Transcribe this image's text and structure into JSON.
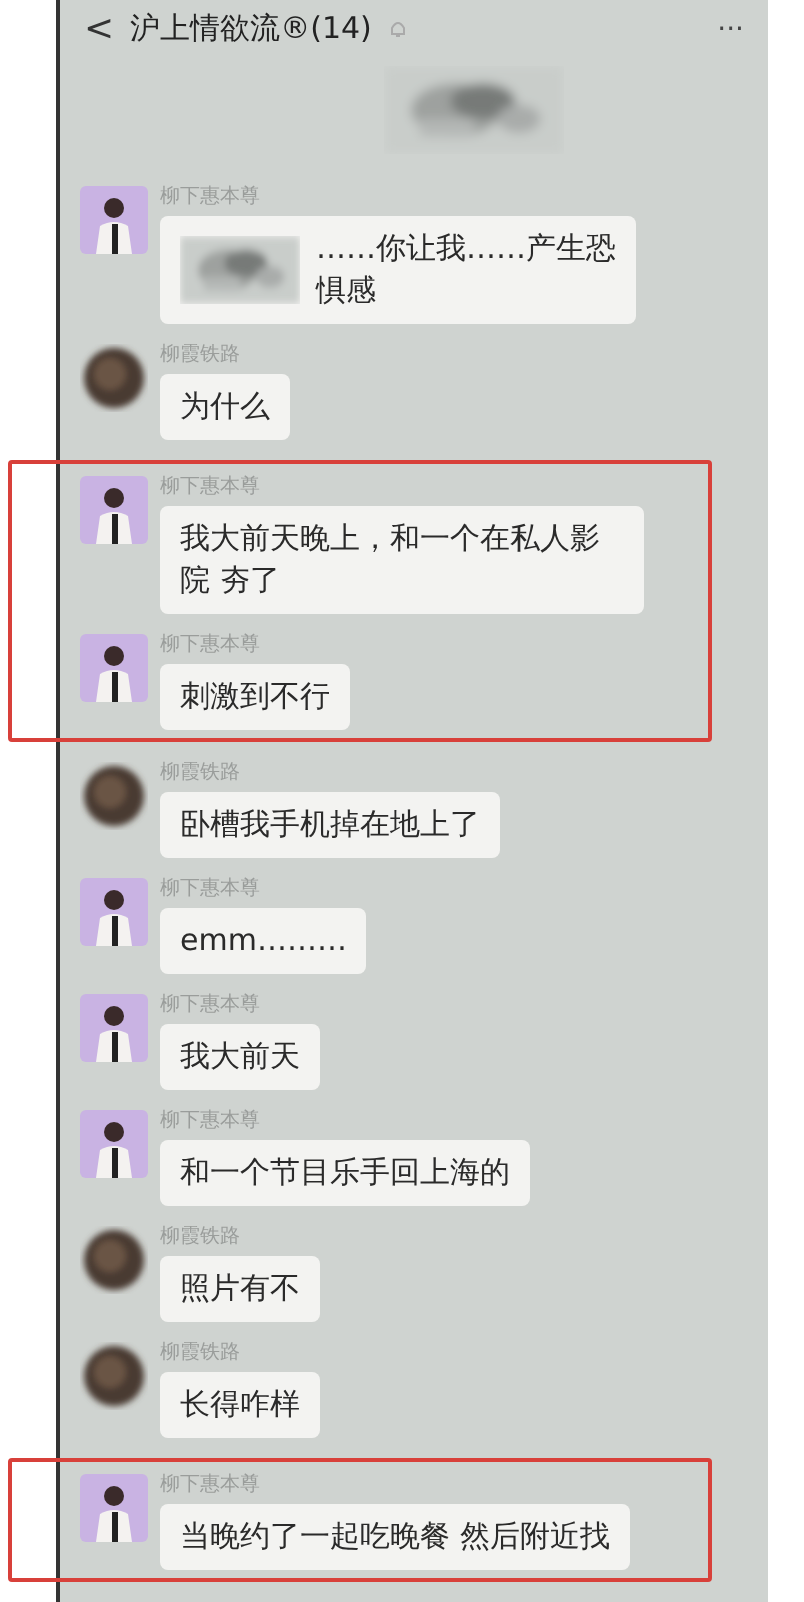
{
  "header": {
    "back": "<",
    "title": "沪上情欲流®(14)",
    "more": "···"
  },
  "sections": [
    {
      "highlighted": false,
      "items": [
        {
          "kind": "picture"
        },
        {
          "kind": "picture_text",
          "avatar_blurred": false,
          "sender": "柳下惠本尊",
          "text": "……你让我……产生恐惧感"
        },
        {
          "kind": "text",
          "avatar_blurred": true,
          "sender": "柳霞铁路",
          "text": "为什么"
        }
      ]
    },
    {
      "highlighted": true,
      "items": [
        {
          "kind": "text",
          "avatar_blurred": false,
          "sender": "柳下惠本尊",
          "text": "我大前天晚上，和一个在私人影院 夯了"
        },
        {
          "kind": "text",
          "avatar_blurred": false,
          "sender": "柳下惠本尊",
          "text": "刺激到不行"
        }
      ]
    },
    {
      "highlighted": false,
      "items": [
        {
          "kind": "text",
          "avatar_blurred": true,
          "sender": "柳霞铁路",
          "text": "卧槽我手机掉在地上了"
        },
        {
          "kind": "text",
          "avatar_blurred": false,
          "sender": "柳下惠本尊",
          "text": "emm………"
        },
        {
          "kind": "text",
          "avatar_blurred": false,
          "sender": "柳下惠本尊",
          "text": "我大前天"
        },
        {
          "kind": "text",
          "avatar_blurred": false,
          "sender": "柳下惠本尊",
          "text": "和一个节目乐手回上海的"
        },
        {
          "kind": "text",
          "avatar_blurred": true,
          "sender": "柳霞铁路",
          "text": "照片有不"
        },
        {
          "kind": "text",
          "avatar_blurred": true,
          "sender": "柳霞铁路",
          "text": "长得咋样"
        }
      ]
    },
    {
      "highlighted": true,
      "items": [
        {
          "kind": "text",
          "avatar_blurred": false,
          "sender": "柳下惠本尊",
          "text": "当晚约了一起吃晚餐 然后附近找"
        }
      ]
    }
  ]
}
